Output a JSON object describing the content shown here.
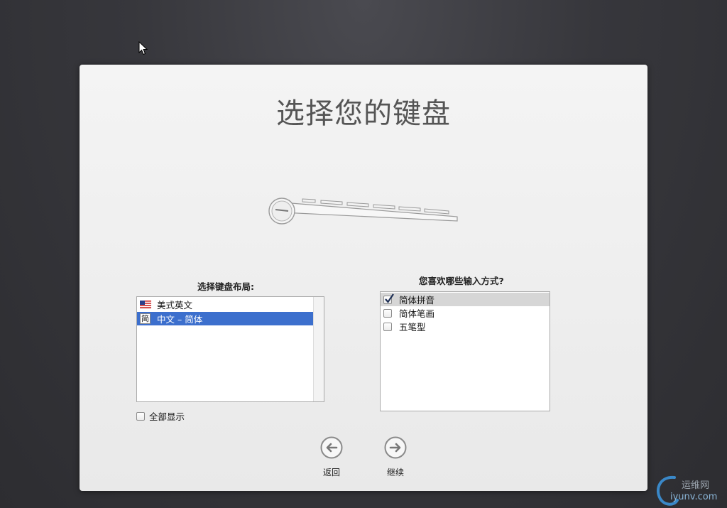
{
  "title": "选择您的键盘",
  "layout_section": {
    "label": "选择键盘布局:",
    "items": [
      {
        "label": "美式英文",
        "icon": "us-flag-icon",
        "selected": false
      },
      {
        "label": "中文 – 简体",
        "icon": "jian-input-icon",
        "icon_glyph": "简",
        "selected": true
      }
    ],
    "show_all_label": "全部显示",
    "show_all_checked": false
  },
  "input_section": {
    "label": "您喜欢哪些输入方式?",
    "items": [
      {
        "label": "简体拼音",
        "checked": true
      },
      {
        "label": "简体笔画",
        "checked": false
      },
      {
        "label": "五笔型",
        "checked": false
      }
    ]
  },
  "nav": {
    "back_label": "返回",
    "continue_label": "继续"
  },
  "watermark": {
    "line1": "运维网",
    "line2": "iyunv.com"
  },
  "colors": {
    "selection": "#3c6fcd",
    "panel": "#efefef",
    "backdrop": "#37373c"
  }
}
